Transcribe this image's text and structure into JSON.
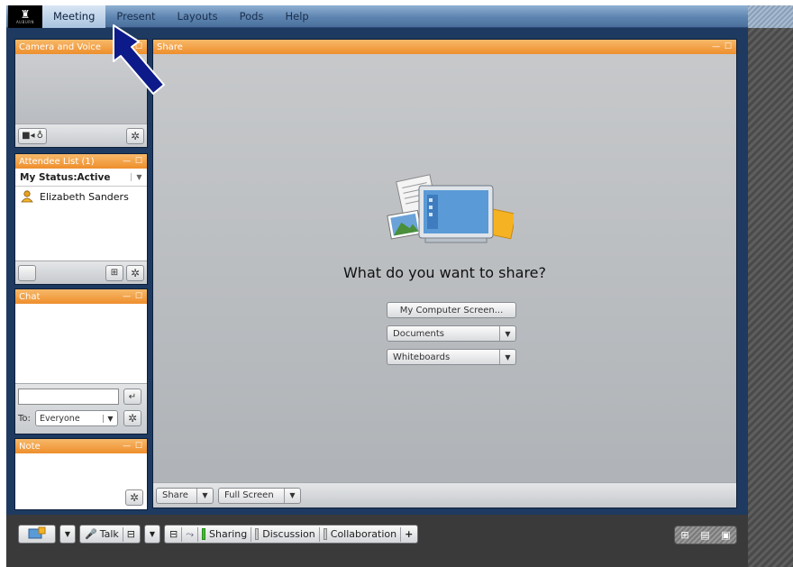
{
  "menu": {
    "logo_text": "AUBURN",
    "items": [
      "Meeting",
      "Present",
      "Layouts",
      "Pods",
      "Help"
    ],
    "active": "Meeting"
  },
  "camera_pod": {
    "title": "Camera and Voice",
    "controls": "— ☐"
  },
  "attendee_pod": {
    "title": "Attendee List (1)",
    "controls": "— ☐",
    "my_status": "My Status:Active",
    "attendees": [
      "Elizabeth Sanders"
    ]
  },
  "chat_pod": {
    "title": "Chat",
    "controls": "— ☐",
    "to_label": "To:",
    "to_value": "Everyone",
    "input_value": ""
  },
  "note_pod": {
    "title": "Note",
    "controls": "— ☐"
  },
  "share_pod": {
    "title": "Share",
    "controls": "— ☐",
    "prompt": "What do you want to share?",
    "options": {
      "computer_screen": "My Computer Screen...",
      "documents": "Documents",
      "whiteboards": "Whiteboards"
    },
    "footer": {
      "share": "Share",
      "full_screen": "Full Screen"
    }
  },
  "toolbar": {
    "talk": "Talk",
    "sharing": "Sharing",
    "discussion": "Discussion",
    "collaboration": "Collaboration",
    "add": "+"
  },
  "colors": {
    "pod_header": "#ee8e2c",
    "frame": "#1e3a60",
    "menubar": "#5d84b0"
  }
}
